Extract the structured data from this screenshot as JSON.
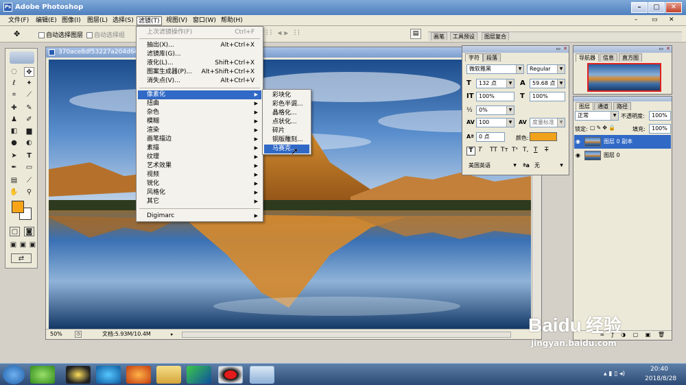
{
  "app": {
    "title": "Adobe Photoshop"
  },
  "menubar": [
    "文件(F)",
    "编辑(E)",
    "图像(I)",
    "图层(L)",
    "选择(S)",
    "滤镜(T)",
    "视图(V)",
    "窗口(W)",
    "帮助(H)"
  ],
  "options": {
    "auto_select_layer": "自动选择图层",
    "auto_select_group": "自动选择组",
    "tabs": [
      "画笔",
      "工具预设",
      "图层复合"
    ]
  },
  "document": {
    "title": "370ace8df53227a204d64c",
    "zoom": "50%",
    "doc_info": "文档:5.93M/10.4M"
  },
  "filter_menu": {
    "items": [
      {
        "label": "上次滤镜操作(F)",
        "shortcut": "Ctrl+F"
      },
      {
        "label": "抽出(X)...",
        "shortcut": "Alt+Ctrl+X"
      },
      {
        "label": "滤镜库(G)...",
        "shortcut": ""
      },
      {
        "label": "液化(L)...",
        "shortcut": "Shift+Ctrl+X"
      },
      {
        "label": "图案生成器(P)...",
        "shortcut": "Alt+Shift+Ctrl+X"
      },
      {
        "label": "消失点(V)...",
        "shortcut": "Alt+Ctrl+V"
      },
      {
        "label": "像素化",
        "shortcut": ""
      },
      {
        "label": "扭曲",
        "shortcut": ""
      },
      {
        "label": "杂色",
        "shortcut": ""
      },
      {
        "label": "模糊",
        "shortcut": ""
      },
      {
        "label": "渲染",
        "shortcut": ""
      },
      {
        "label": "画笔描边",
        "shortcut": ""
      },
      {
        "label": "素描",
        "shortcut": ""
      },
      {
        "label": "纹理",
        "shortcut": ""
      },
      {
        "label": "艺术效果",
        "shortcut": ""
      },
      {
        "label": "视频",
        "shortcut": ""
      },
      {
        "label": "锐化",
        "shortcut": ""
      },
      {
        "label": "风格化",
        "shortcut": ""
      },
      {
        "label": "其它",
        "shortcut": ""
      },
      {
        "label": "Digimarc",
        "shortcut": ""
      }
    ]
  },
  "pixelate_submenu": [
    "彩块化",
    "彩色半调...",
    "晶格化...",
    "点状化...",
    "碎片",
    "铜版雕刻...",
    "马赛克..."
  ],
  "character_panel": {
    "tabs": [
      "字符",
      "段落"
    ],
    "font": "微软雅黑",
    "style": "Regular",
    "size": "132 点",
    "leading": "59.68 点",
    "vscale": "100%",
    "hscale": "100%",
    "kerning": "0%",
    "tracking": "100",
    "kern_mode": "度量标准",
    "baseline": "0 点",
    "color_label": "颜色:",
    "language": "美国英语",
    "aa_label": "a",
    "aa": "无",
    "text_color": "#f0a21b"
  },
  "navigator": {
    "tabs": [
      "导航器",
      "信息",
      "直方图"
    ]
  },
  "layers_panel": {
    "tabs": [
      "图层",
      "通道",
      "路径"
    ],
    "blend": "正常",
    "opacity_label": "不透明度:",
    "opacity": "100%",
    "lock_label": "锁定:",
    "fill_label": "填充:",
    "fill": "100%",
    "layers": [
      {
        "name": "图层 0 副本",
        "selected": true
      },
      {
        "name": "图层 0",
        "selected": false
      }
    ]
  },
  "watermark": {
    "brand": "Bai",
    "paw": "du",
    "cn": "经验",
    "url": "jingyan.baidu.com"
  },
  "taskbar": {
    "time": "20:40",
    "date": "2018/8/28"
  },
  "colors": {
    "foreground": "#f7a418",
    "selection": "#3169c6"
  }
}
